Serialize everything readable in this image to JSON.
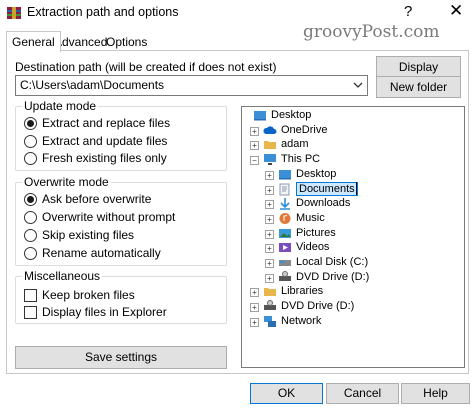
{
  "window": {
    "title": "Extraction path and options",
    "help_label": "?",
    "close_label": "✕",
    "watermark": "groovyPost.com"
  },
  "tabs": [
    {
      "label": "General",
      "active": true
    },
    {
      "label": "Advanced",
      "active": false
    },
    {
      "label": "Options",
      "active": false
    }
  ],
  "destination": {
    "label": "Destination path (will be created if does not exist)",
    "value": "C:\\Users\\adam\\Documents"
  },
  "side_buttons": {
    "display": "Display",
    "new_folder": "New folder"
  },
  "update_mode": {
    "title": "Update mode",
    "options": [
      {
        "label": "Extract and replace files",
        "selected": true
      },
      {
        "label": "Extract and update files",
        "selected": false
      },
      {
        "label": "Fresh existing files only",
        "selected": false
      }
    ]
  },
  "overwrite_mode": {
    "title": "Overwrite mode",
    "options": [
      {
        "label": "Ask before overwrite",
        "selected": true
      },
      {
        "label": "Overwrite without prompt",
        "selected": false
      },
      {
        "label": "Skip existing files",
        "selected": false
      },
      {
        "label": "Rename automatically",
        "selected": false
      }
    ]
  },
  "misc": {
    "title": "Miscellaneous",
    "options": [
      {
        "label": "Keep broken files",
        "checked": false
      },
      {
        "label": "Display files in Explorer",
        "checked": false
      }
    ]
  },
  "save_settings": "Save settings",
  "tree": [
    {
      "label": "Desktop",
      "icon": "desktop-icon",
      "level": 0,
      "toggle": "",
      "color": "#3b8fd6"
    },
    {
      "label": "OneDrive",
      "icon": "cloud-icon",
      "level": 1,
      "toggle": "+",
      "color": "#0a64c8"
    },
    {
      "label": "adam",
      "icon": "folder-icon",
      "level": 1,
      "toggle": "+",
      "color": "#e8b64a"
    },
    {
      "label": "This PC",
      "icon": "computer-icon",
      "level": 1,
      "toggle": "−",
      "color": "#3b8fd6"
    },
    {
      "label": "Desktop",
      "icon": "desktop-icon",
      "level": 2,
      "toggle": "+",
      "color": "#3b8fd6"
    },
    {
      "label": "Documents",
      "icon": "documents-icon",
      "level": 2,
      "toggle": "+",
      "color": "#8a9bb0",
      "selected": true
    },
    {
      "label": "Downloads",
      "icon": "download-arrow-icon",
      "level": 2,
      "toggle": "+",
      "color": "#2f8fd6"
    },
    {
      "label": "Music",
      "icon": "music-icon",
      "level": 2,
      "toggle": "+",
      "color": "#e07a3a"
    },
    {
      "label": "Pictures",
      "icon": "pictures-icon",
      "level": 2,
      "toggle": "+",
      "color": "#3a9ad9"
    },
    {
      "label": "Videos",
      "icon": "videos-icon",
      "level": 2,
      "toggle": "+",
      "color": "#7b4bbf"
    },
    {
      "label": "Local Disk (C:)",
      "icon": "disk-icon",
      "level": 2,
      "toggle": "+",
      "color": "#888888"
    },
    {
      "label": "DVD Drive (D:)",
      "icon": "dvd-drive-icon",
      "level": 2,
      "toggle": "+",
      "color": "#555555"
    },
    {
      "label": "Libraries",
      "icon": "libraries-icon",
      "level": 1,
      "toggle": "+",
      "color": "#e8b64a"
    },
    {
      "label": "DVD Drive (D:)",
      "icon": "dvd-drive-icon",
      "level": 1,
      "toggle": "+",
      "color": "#555555"
    },
    {
      "label": "Network",
      "icon": "network-icon",
      "level": 1,
      "toggle": "+",
      "color": "#3b8fd6"
    }
  ],
  "footer": {
    "ok": "OK",
    "cancel": "Cancel",
    "help": "Help"
  }
}
